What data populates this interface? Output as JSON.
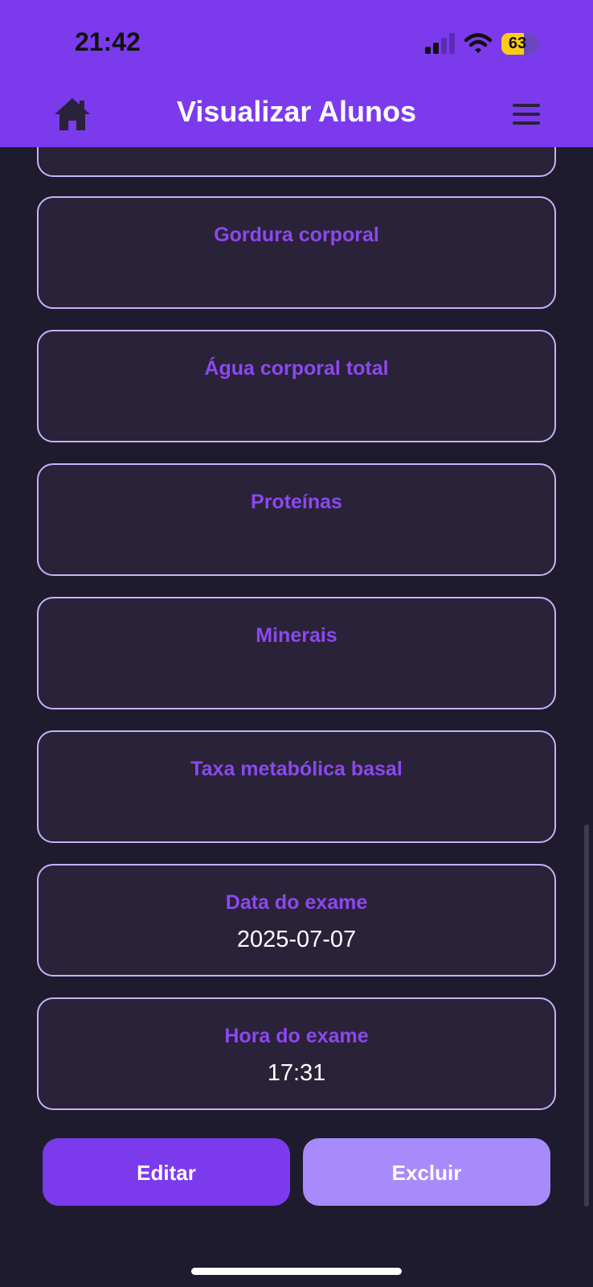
{
  "status_bar": {
    "time": "21:42",
    "battery_level": 63,
    "battery_label": "63"
  },
  "header": {
    "title": "Visualizar Alunos",
    "home_icon": "home-icon",
    "menu_icon": "hamburger-menu-icon"
  },
  "cards": [
    {
      "label": "Gordura corporal",
      "value": ""
    },
    {
      "label": "Água corporal total",
      "value": ""
    },
    {
      "label": "Proteínas",
      "value": ""
    },
    {
      "label": "Minerais",
      "value": ""
    },
    {
      "label": "Taxa metabólica basal",
      "value": ""
    },
    {
      "label": "Data do exame",
      "value": "2025-07-07"
    },
    {
      "label": "Hora do exame",
      "value": "17:31"
    }
  ],
  "actions": {
    "edit_label": "Editar",
    "delete_label": "Excluir"
  },
  "colors": {
    "primary": "#7c3aed",
    "secondary": "#a78bfa",
    "background": "#1e1b2e",
    "card": "#2a2238",
    "label": "#8b48ef"
  }
}
